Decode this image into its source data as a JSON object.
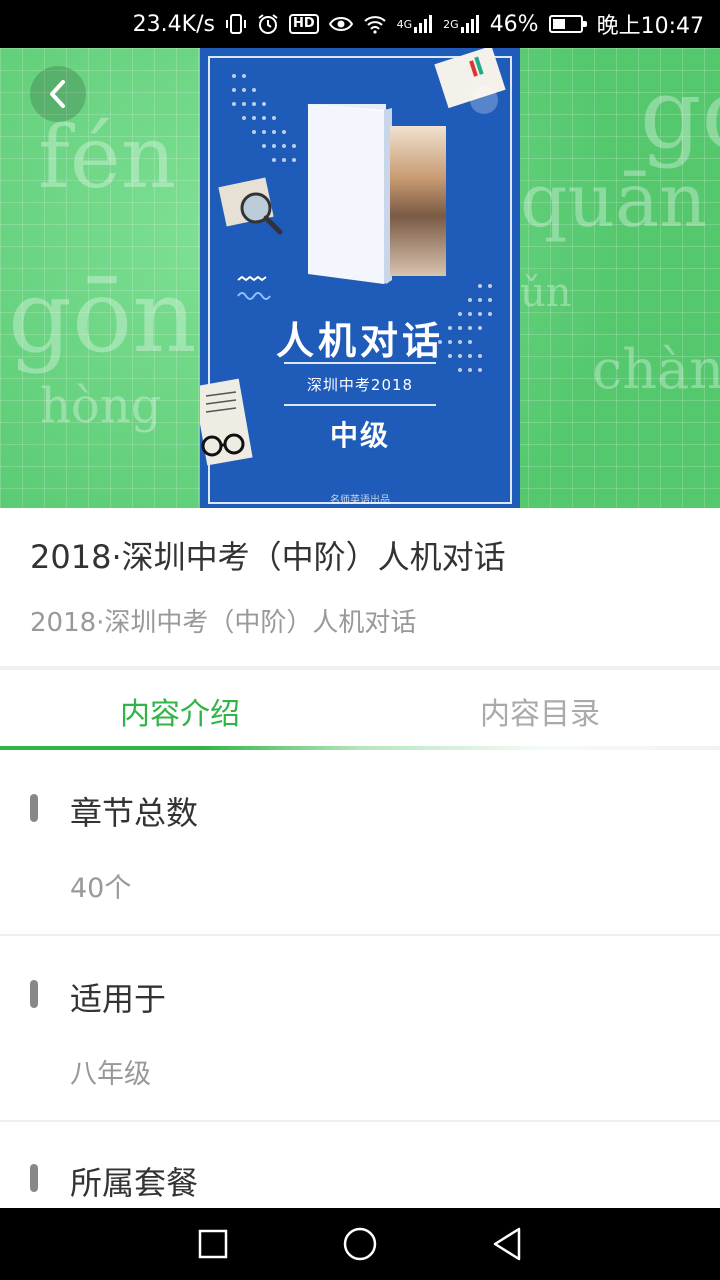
{
  "status_bar": {
    "speed": "23.4K/s",
    "hd_label": "HD",
    "net_4g": "4G",
    "net_2g": "2G",
    "battery": "46%",
    "battery_level": 0.46,
    "time": "晚上10:47"
  },
  "hero": {
    "pinyin": [
      "fén",
      "gōn",
      "hòng",
      "quān",
      "ǔn",
      "chàng",
      "go"
    ],
    "cover": {
      "title": "人机对话",
      "subtitle": "深圳中考2018",
      "level": "中级",
      "publisher": "名师英语出品"
    }
  },
  "product": {
    "title": "2018·深圳中考（中阶）人机对话",
    "subtitle": "2018·深圳中考（中阶）人机对话"
  },
  "tabs": [
    {
      "label": "内容介绍",
      "active": true
    },
    {
      "label": "内容目录",
      "active": false
    }
  ],
  "sections": [
    {
      "label": "章节总数",
      "value": "40个"
    },
    {
      "label": "适用于",
      "value": "八年级"
    },
    {
      "label": "所属套餐",
      "value": ""
    }
  ],
  "colors": {
    "accent": "#2fb545",
    "hero_green": "#5ecf78",
    "cover_blue": "#1f5bb8"
  }
}
